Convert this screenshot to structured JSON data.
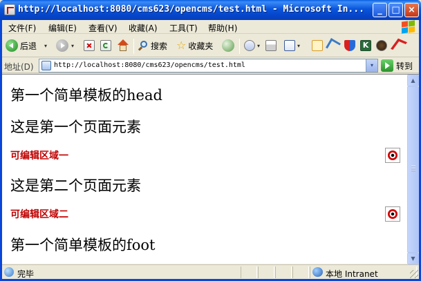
{
  "window": {
    "title": "http://localhost:8080/cms623/opencms/test.html - Microsoft In...",
    "minimize": "_",
    "maximize": "□",
    "close": "×"
  },
  "menu": {
    "items": [
      "文件(F)",
      "编辑(E)",
      "查看(V)",
      "收藏(A)",
      "工具(T)",
      "帮助(H)"
    ]
  },
  "toolbar": {
    "back_label": "后退",
    "search_label": "搜索",
    "favorites_label": "收藏夹",
    "dropdown_glyph": "▾"
  },
  "address": {
    "label": "地址(D)",
    "url": "http://localhost:8080/cms623/opencms/test.html",
    "go_label": "转到"
  },
  "page": {
    "head": "第一个简单模板的head",
    "element1": "这是第一个页面元素",
    "editable1": "可编辑区域一",
    "element2": "这是第二个页面元素",
    "editable2": "可编辑区域二",
    "foot": "第一个简单模板的foot"
  },
  "status": {
    "text": "完毕",
    "zone": "本地 Intranet"
  },
  "colors": {
    "title_bar": "#0a55dc",
    "editable_label": "#c00000",
    "chrome": "#ece9d8"
  }
}
